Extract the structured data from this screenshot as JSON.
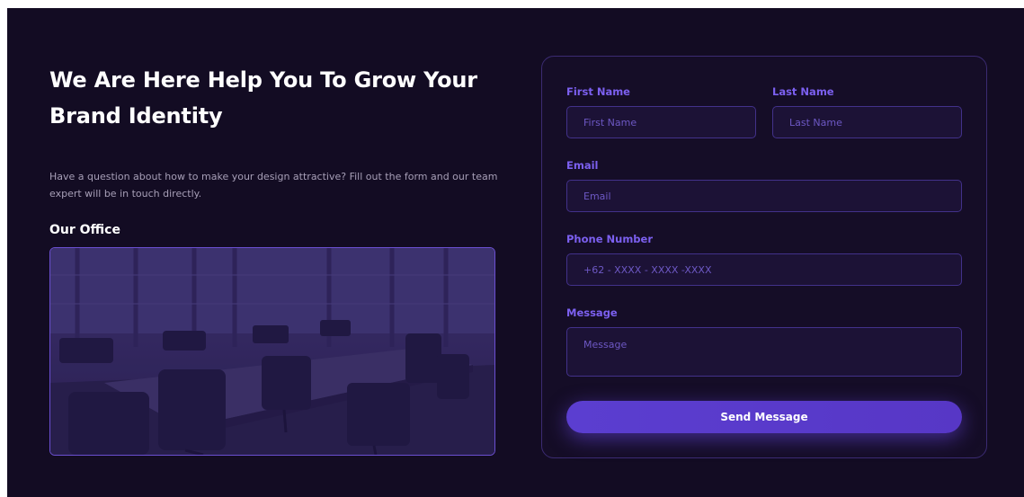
{
  "hero": {
    "title": "We Are Here Help You To Grow Your Brand Identity",
    "description": "Have a question about how to make your design attractive? Fill out the form and our team expert will be in touch directly.",
    "office_heading": "Our Office"
  },
  "form": {
    "first_name": {
      "label": "First Name",
      "placeholder": "First Name"
    },
    "last_name": {
      "label": "Last Name",
      "placeholder": "Last Name"
    },
    "email": {
      "label": "Email",
      "placeholder": "Email"
    },
    "phone": {
      "label": "Phone Number",
      "placeholder": "+62 - XXXX - XXXX -XXXX"
    },
    "message": {
      "label": "Message",
      "placeholder": "Message"
    },
    "submit_label": "Send Message"
  },
  "colors": {
    "background": "#130c23",
    "accent": "#7c60f0",
    "button": "#5b3ed0",
    "text": "#ffffff"
  }
}
